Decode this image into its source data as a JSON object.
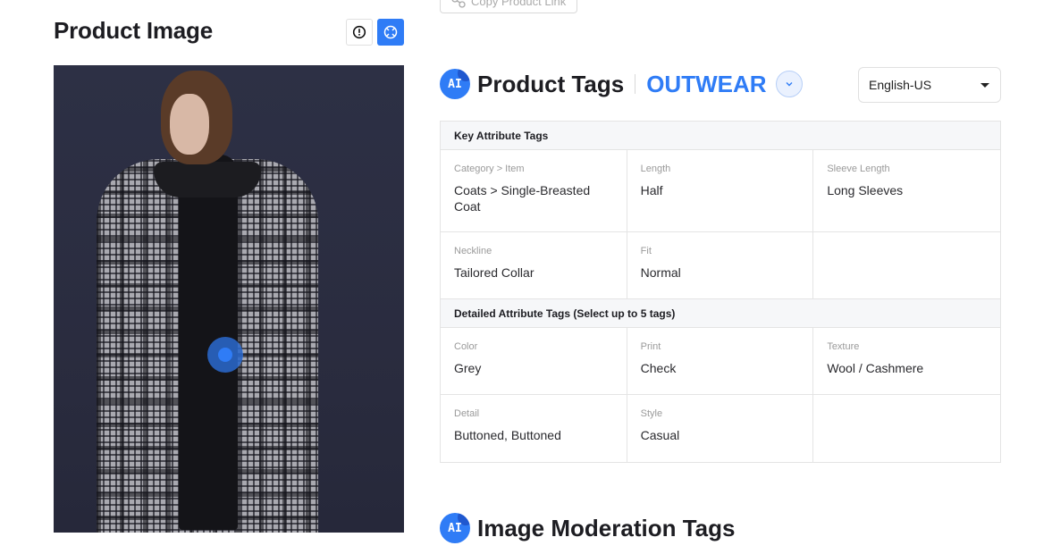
{
  "left_panel": {
    "title": "Product Image",
    "info_icon": "info-circle-icon",
    "focus_icon": "focus-target-icon"
  },
  "copy_link": {
    "label": "Copy Product Link",
    "icon": "link-icon"
  },
  "product_tags": {
    "ai_badge": "AI",
    "title": "Product Tags",
    "category": "OUTWEAR",
    "toggle_icon": "chevron-down-icon",
    "language": "English-US",
    "key_group": {
      "title": "Key Attribute Tags",
      "rows": [
        [
          {
            "label": "Category > Item",
            "value": "Coats > Single-Breasted Coat"
          },
          {
            "label": "Length",
            "value": "Half"
          },
          {
            "label": "Sleeve Length",
            "value": "Long Sleeves"
          }
        ],
        [
          {
            "label": "Neckline",
            "value": "Tailored Collar"
          },
          {
            "label": "Fit",
            "value": "Normal"
          },
          {
            "label": "",
            "value": ""
          }
        ]
      ]
    },
    "detail_group": {
      "title": "Detailed Attribute Tags (Select up to 5 tags)",
      "rows": [
        [
          {
            "label": "Color",
            "value": "Grey"
          },
          {
            "label": "Print",
            "value": "Check"
          },
          {
            "label": "Texture",
            "value": "Wool / Cashmere"
          }
        ],
        [
          {
            "label": "Detail",
            "value": "Buttoned, Buttoned"
          },
          {
            "label": "Style",
            "value": "Casual"
          },
          {
            "label": "",
            "value": ""
          }
        ]
      ]
    }
  },
  "moderation": {
    "ai_badge": "AI",
    "title": "Image Moderation Tags"
  },
  "colors": {
    "accent": "#2f7cf6",
    "text": "#1d1d22",
    "muted": "#9a9a9a",
    "border": "#e4e4e4"
  }
}
